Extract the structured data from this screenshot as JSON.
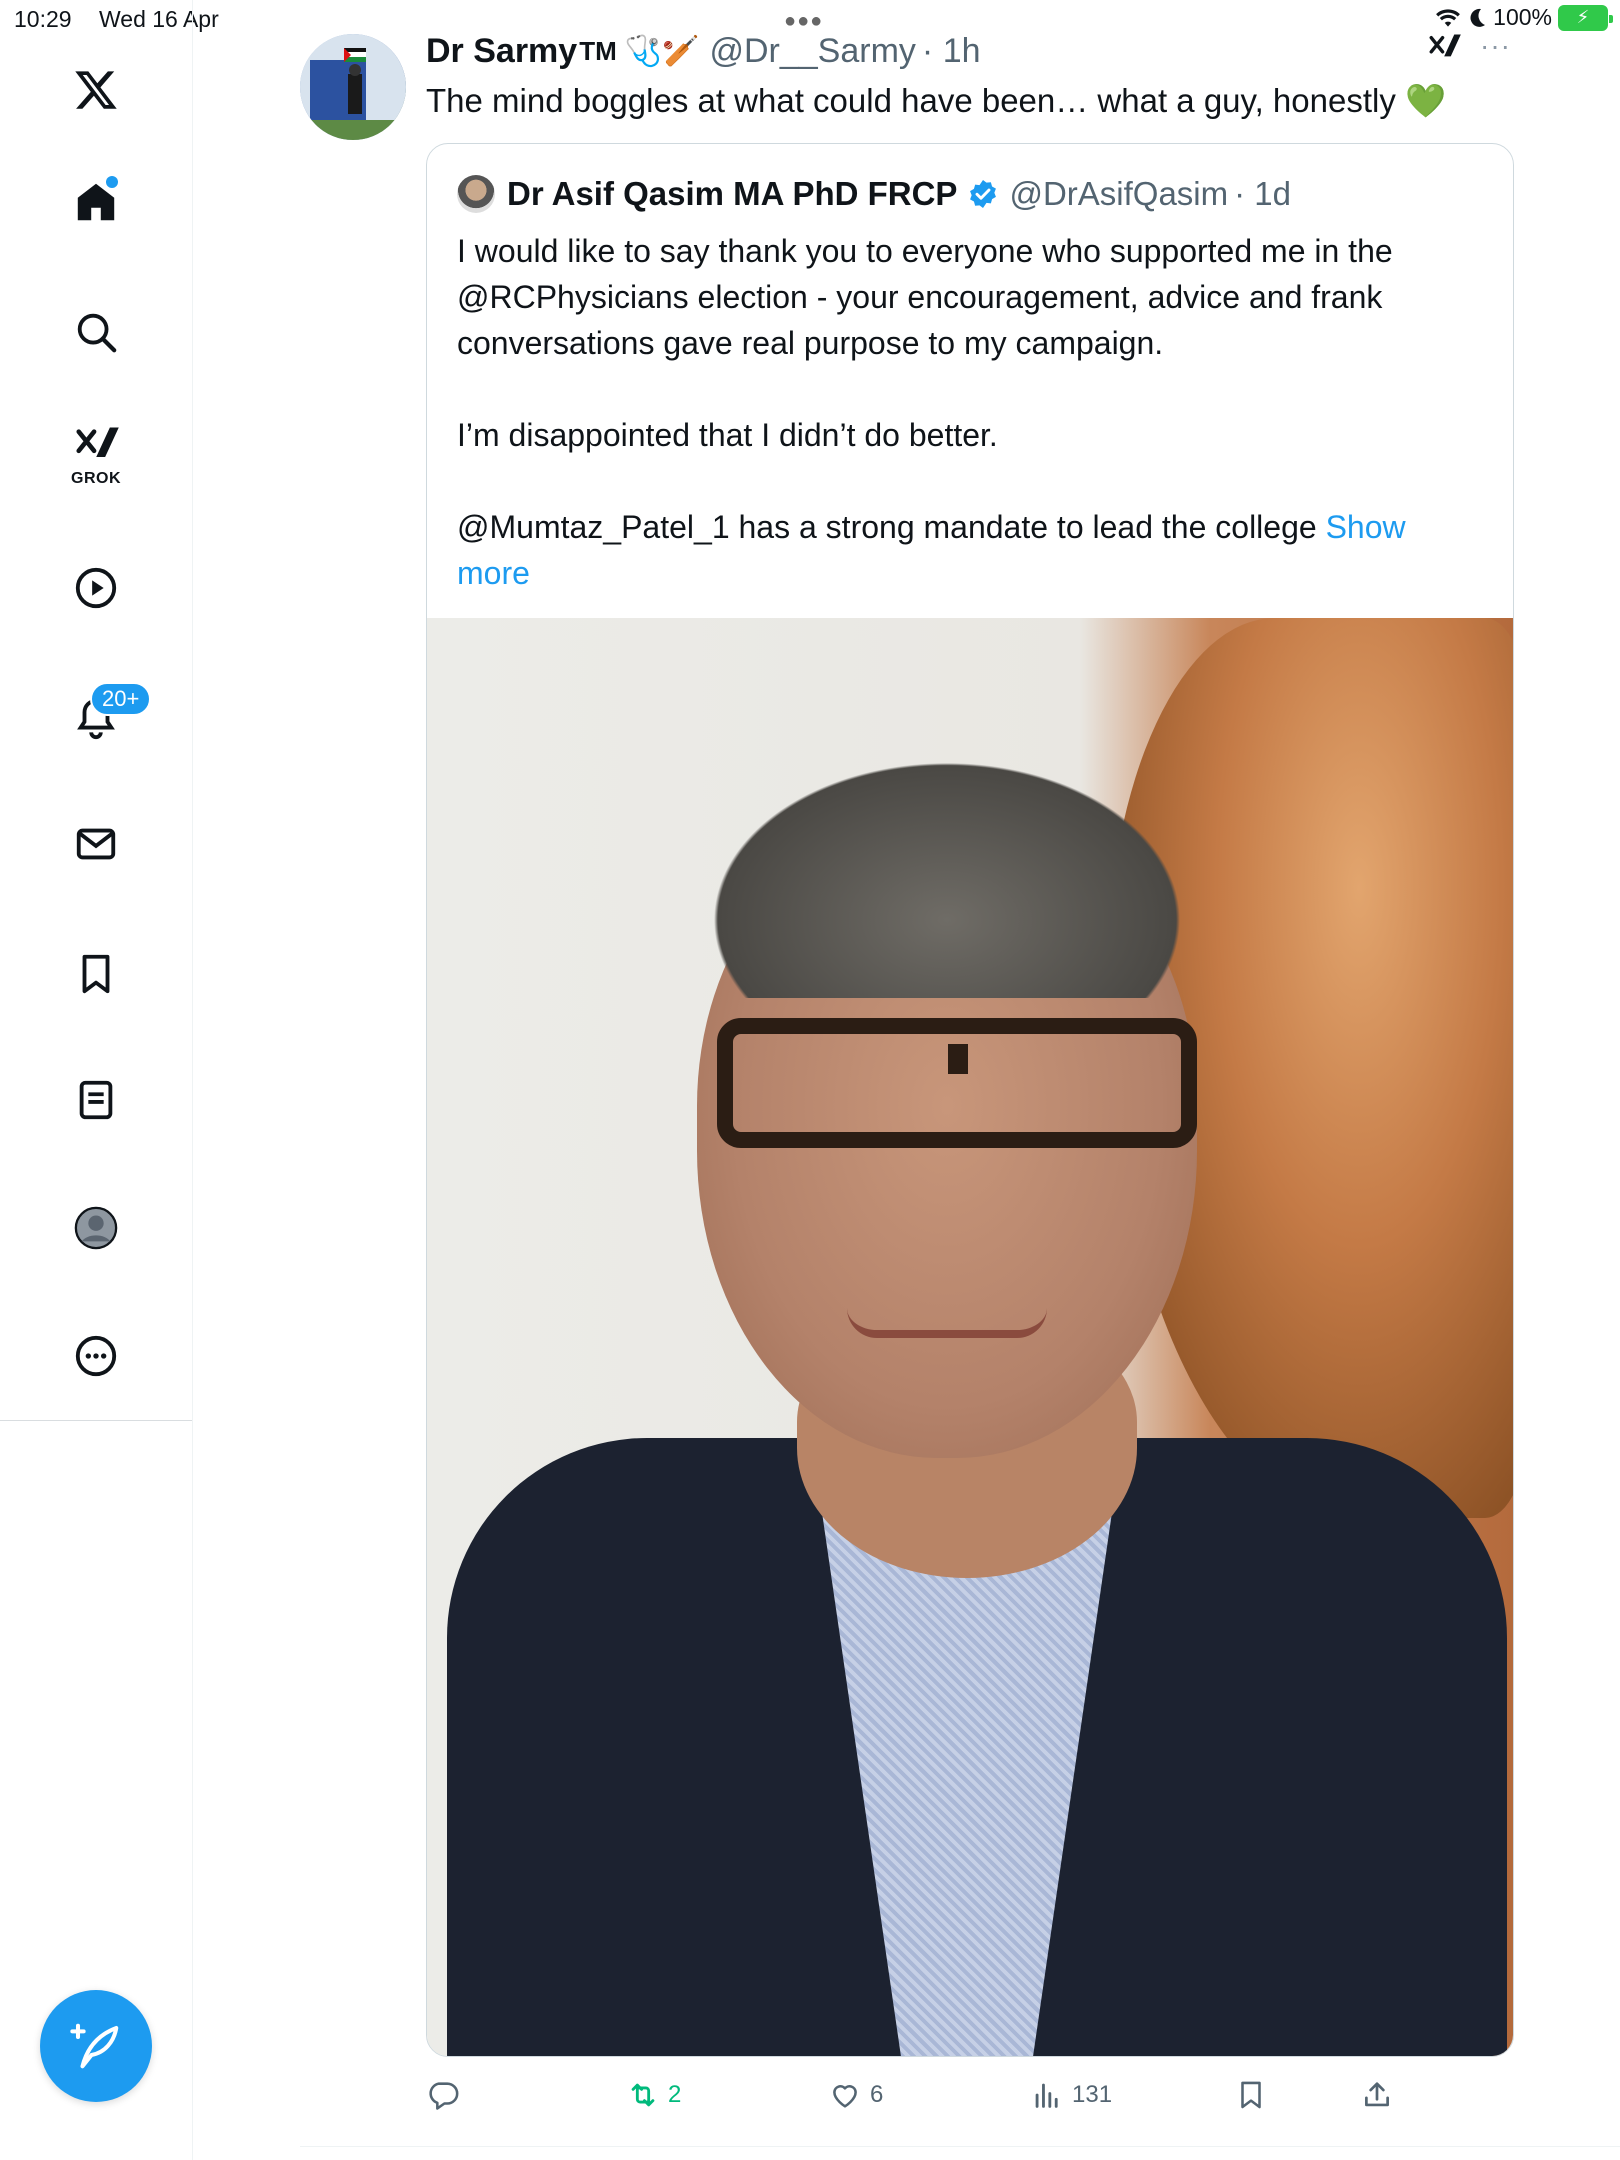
{
  "status_bar": {
    "time": "10:29",
    "date": "Wed 16 Apr",
    "battery": "100%"
  },
  "sidebar": {
    "items": [
      {
        "name": "x-logo-icon"
      },
      {
        "name": "home-icon"
      },
      {
        "name": "search-icon"
      },
      {
        "name": "grok-icon",
        "label": "GROK"
      },
      {
        "name": "video-icon"
      },
      {
        "name": "notifications-icon",
        "badge": "20+"
      },
      {
        "name": "messages-icon"
      },
      {
        "name": "bookmarks-icon"
      },
      {
        "name": "lists-icon"
      },
      {
        "name": "profile-icon"
      },
      {
        "name": "more-icon"
      }
    ]
  },
  "tweet": {
    "author_name": "Dr Sarmy",
    "author_tm": "TM",
    "author_emoji": "🩺🏏",
    "author_handle": "@Dr__Sarmy",
    "time": "· 1h",
    "text": "The mind boggles at what could have been… what a guy, honestly",
    "text_emoji": "💚",
    "quote": {
      "author_name": "Dr Asif Qasim MA PhD FRCP",
      "author_handle": "@DrAsifQasim",
      "time": "· 1d",
      "text": "I would like to say thank you to everyone who supported me in the @RCPhysicians election - your encouragement, advice and frank conversations gave real purpose to my campaign.\n\nI’m disappointed that I didn’t do better.\n\n@Mumtaz_Patel_1 has a strong mandate to lead the college ",
      "show_more": "Show more"
    },
    "actions": {
      "replies": "",
      "retweets": "2",
      "likes": "6",
      "views": "131"
    }
  },
  "colors": {
    "accent": "#1d9bf0",
    "retweet": "#00ba7c",
    "secondary_text": "#536471"
  }
}
